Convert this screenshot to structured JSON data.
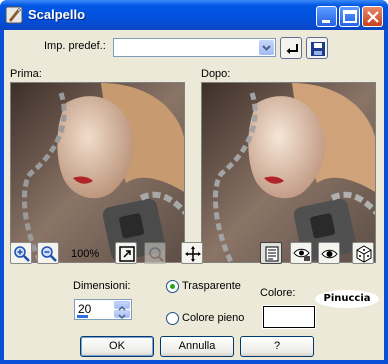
{
  "window": {
    "title": "Scalpello"
  },
  "preset": {
    "label": "Imp. predef.:",
    "value": ""
  },
  "preview": {
    "before_label": "Prima:",
    "after_label": "Dopo:"
  },
  "zoom": {
    "level": "100%"
  },
  "controls": {
    "dimension_label": "Dimensioni:",
    "dimension_value": "20",
    "transparent_label": "Trasparente",
    "fill_label": "Colore pieno",
    "selected_mode": "Trasparente",
    "color_label": "Colore:",
    "color_value": "#ffffff"
  },
  "watermark": "Pinuccia",
  "buttons": {
    "ok": "OK",
    "cancel": "Annulla",
    "help": "?"
  },
  "colors": {
    "title_bar": "#0350db",
    "dialog_bg": "#ece9d8",
    "radio_dot": "#21a121"
  }
}
